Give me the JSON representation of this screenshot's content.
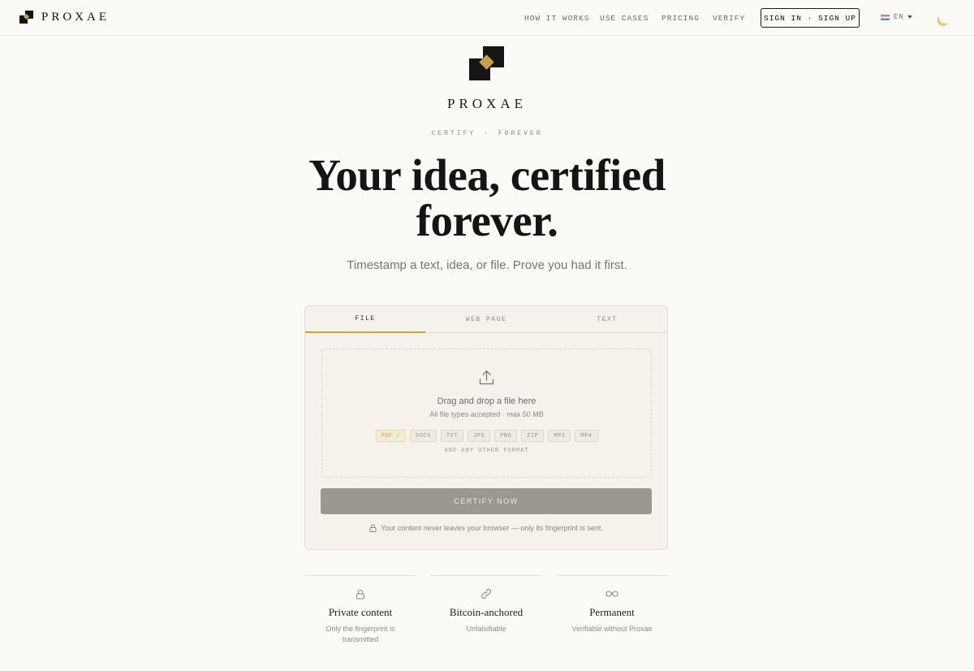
{
  "header": {
    "brand": "PROXAE",
    "nav": [
      "HOW IT WORKS",
      "USE CASES",
      "PRICING",
      "VERIFY"
    ],
    "auth_label": "SIGN IN · SIGN UP",
    "language": "EN"
  },
  "hero": {
    "brand": "PROXAE",
    "eyebrow_left": "CERTIFY",
    "eyebrow_sep": "·",
    "eyebrow_right": "FOREVER",
    "headline_line1": "Your idea, certified",
    "headline_line2": "forever.",
    "subhead": "Timestamp a text, idea, or file. Prove you had it first."
  },
  "certify_card": {
    "tabs": [
      "FILE",
      "WEB PAGE",
      "TEXT"
    ],
    "active_tab": "FILE",
    "drop_title": "Drag and drop a file here",
    "drop_subtitle": "All file types accepted · max 50 MB",
    "formats": [
      "PDF ✓",
      "DOCX",
      "TXT",
      "JPG",
      "PNG",
      "ZIP",
      "MP3",
      "MP4"
    ],
    "any_format": "AND ANY OTHER FORMAT",
    "certify_label": "CERTIFY NOW",
    "privacy_note": "Your content never leaves your browser — only its fingerprint is sent."
  },
  "features": [
    {
      "icon": "lock-icon",
      "title": "Private content",
      "description": "Only the fingerprint is transmitted"
    },
    {
      "icon": "link-icon",
      "title": "Bitcoin-anchored",
      "description": "Unfalsifiable"
    },
    {
      "icon": "infinity-icon",
      "title": "Permanent",
      "description": "Verifiable without Proxae"
    }
  ],
  "colors": {
    "accent": "#c9a24a",
    "background": "#fbfaf6",
    "card": "#f4f2ea",
    "button_disabled": "#9b9891"
  }
}
